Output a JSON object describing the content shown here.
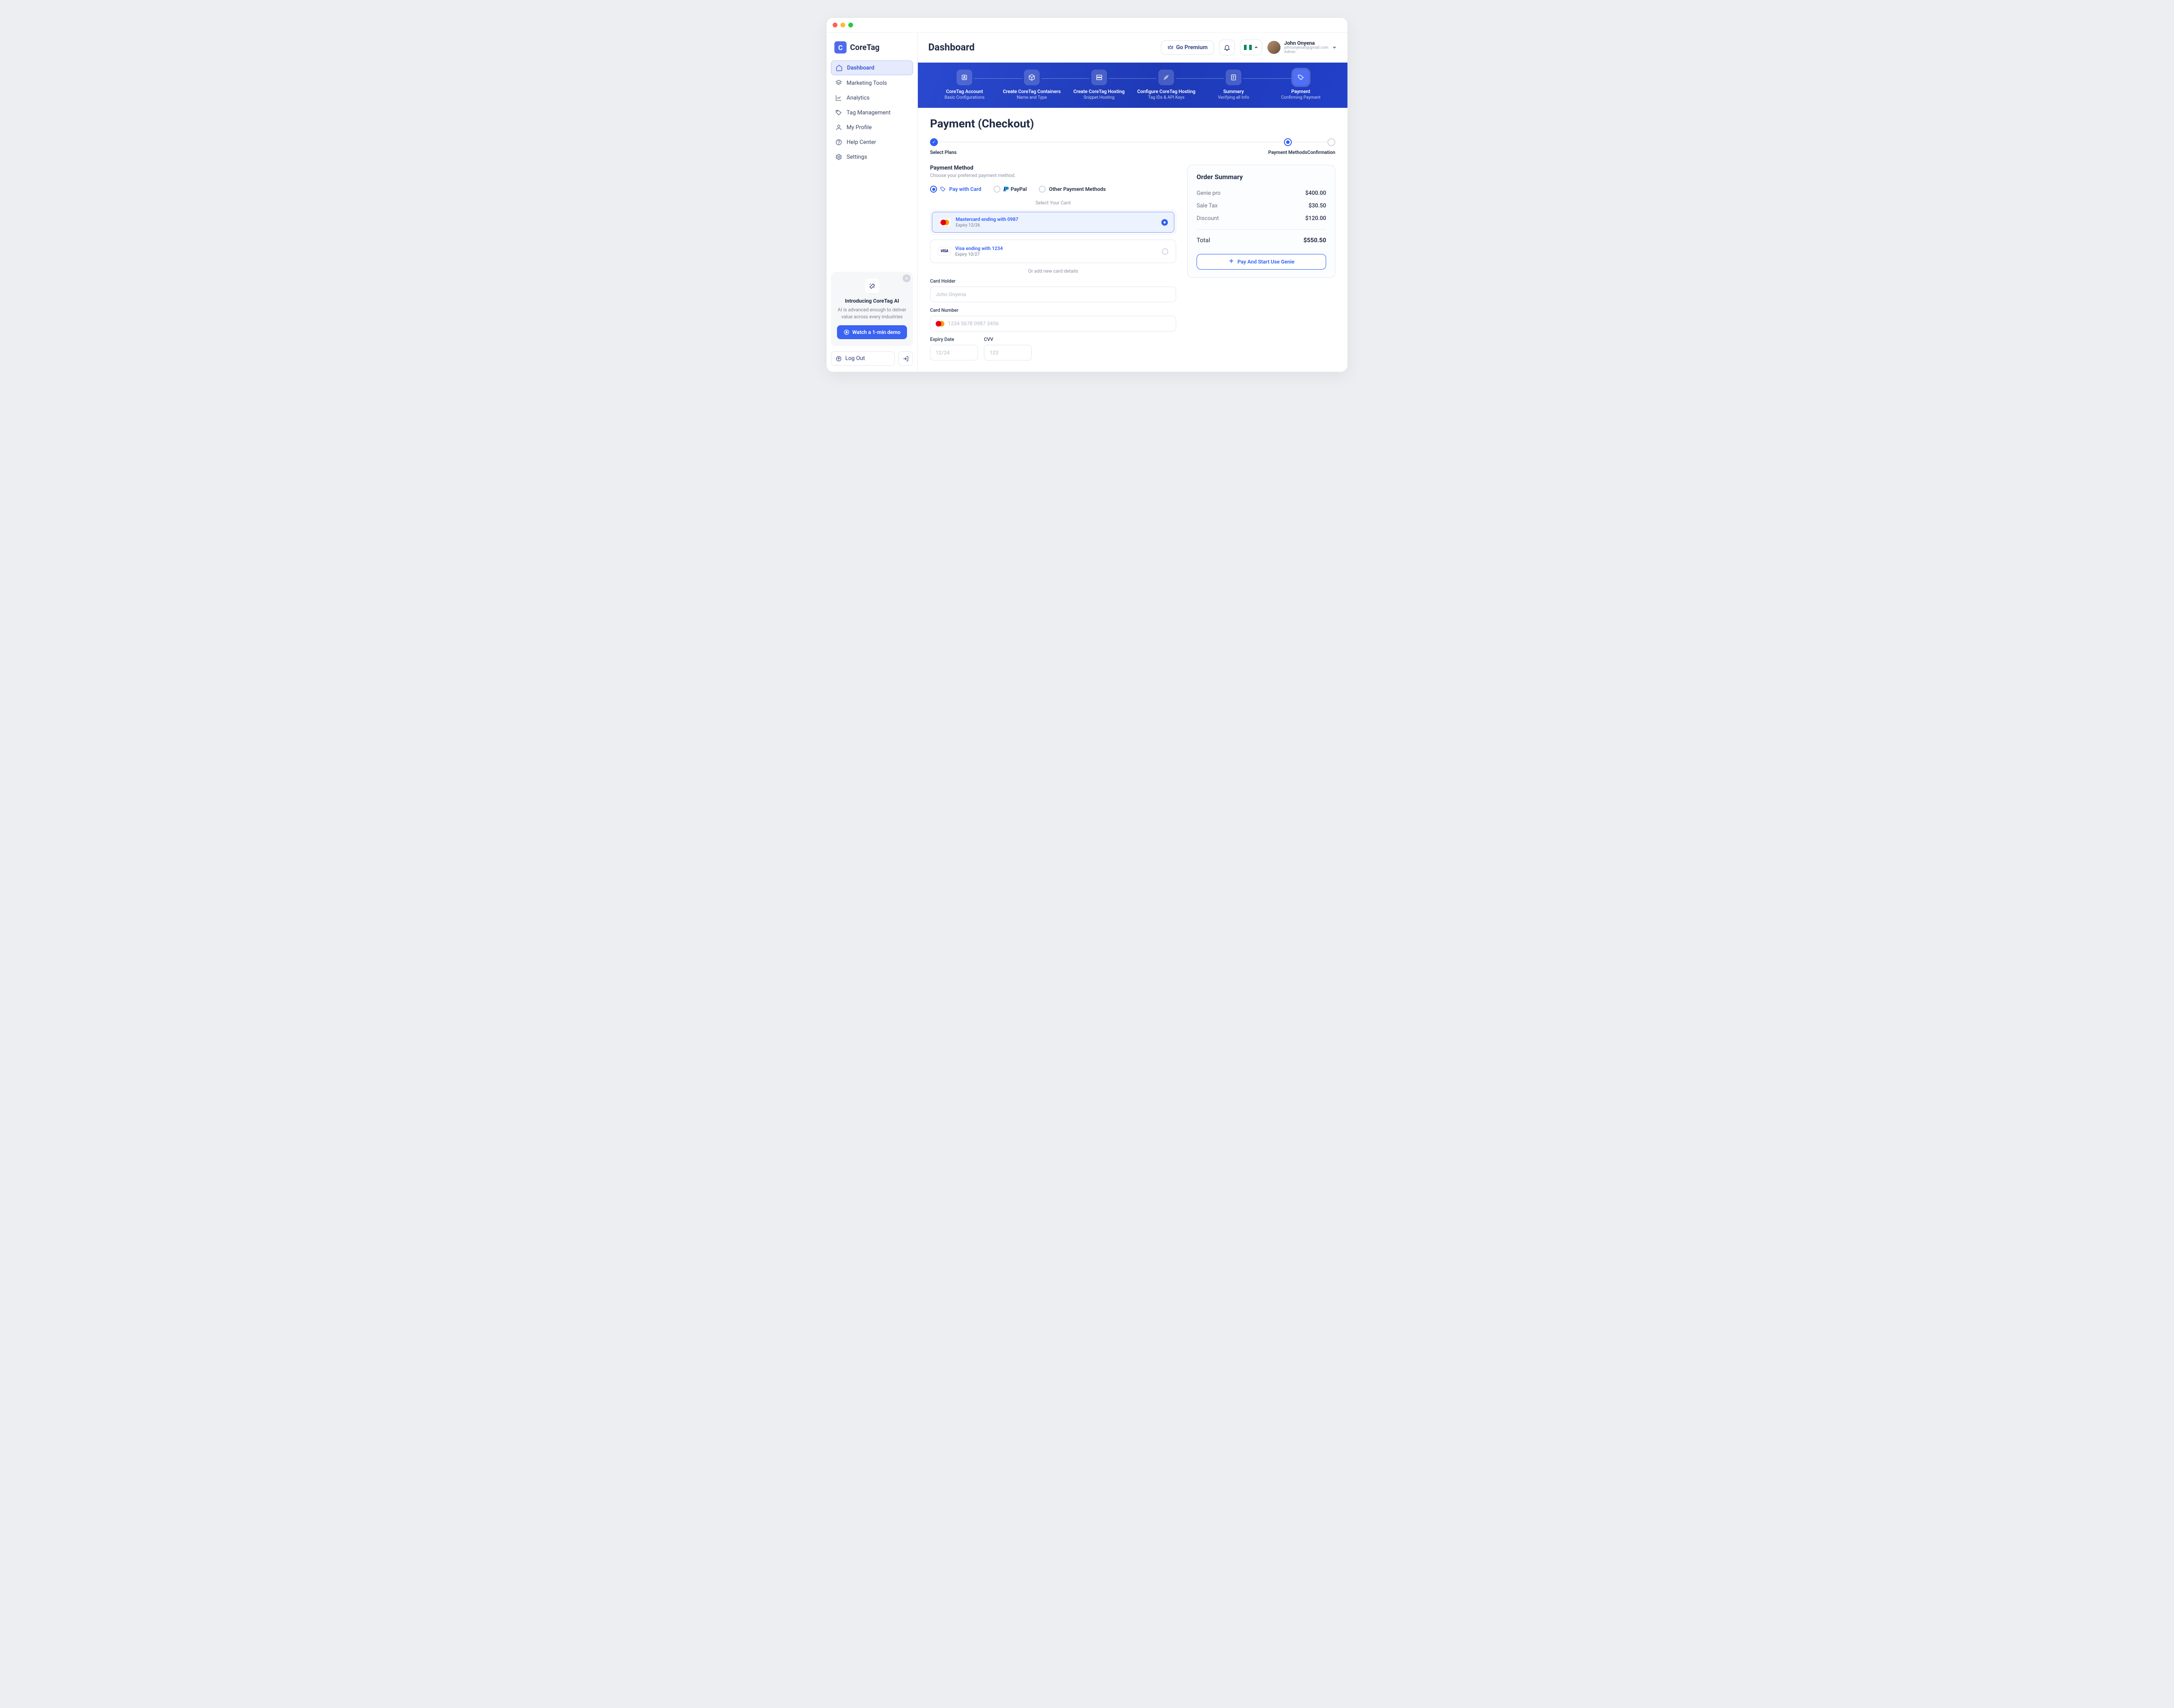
{
  "brand": "CoreTag",
  "page_title": "Dashboard",
  "header": {
    "premium": "Go Premium",
    "user": {
      "name": "John Onyena",
      "email": "johnonyena0@gmail.com",
      "role": "Admin"
    }
  },
  "nav": {
    "dashboard": "Dashboard",
    "marketing": "Marketing Tools",
    "analytics": "Analytics",
    "tag": "Tag Management",
    "profile": "My Profile",
    "help": "Help Center",
    "settings": "Settings"
  },
  "promo": {
    "title": "Introducing CoreTag AI",
    "text": "AI is advanced enough to deliver value across every industries",
    "cta": "Watch a 1-min demo"
  },
  "logout": "Log Out",
  "stepper": [
    {
      "title": "CoreTag Account",
      "sub": "Basic Configurations"
    },
    {
      "title": "Create CoreTag Containers",
      "sub": "Name and Type"
    },
    {
      "title": "Create CoreTag Hosting",
      "sub": "Snippet Hosting"
    },
    {
      "title": "Configure CoreTag Hosting",
      "sub": "Tag IDs & API Keys"
    },
    {
      "title": "Summary",
      "sub": "Verifying all Info"
    },
    {
      "title": "Payment",
      "sub": "Confirming Payment"
    }
  ],
  "checkout": {
    "title": "Payment (Checkout)",
    "progress": {
      "p1": "Select Plans",
      "p2": "Payment Methods",
      "p3": "Confirmation"
    },
    "method": {
      "heading": "Payment Method",
      "sub": "Choose your preferred payment method."
    },
    "options": {
      "card": "Pay with Card",
      "paypal": "PayPal",
      "other": "Other Payment Methods"
    },
    "select_card": "Select Your Card",
    "cards": [
      {
        "name": "Mastercard ending with 0987",
        "expiry": "Expiry 12/26"
      },
      {
        "name": "Visa ending with 1234",
        "expiry": "Expiry 10/27"
      }
    ],
    "add_new": "Or add new card details",
    "fields": {
      "holder": "Card Holder",
      "holder_ph": "John Onyena",
      "number": "Card Number",
      "number_ph": "1234 5678 0987 3456",
      "expiry": "Expiry Date",
      "expiry_ph": "12/24",
      "cvv": "CVV",
      "cvv_ph": "123"
    }
  },
  "summary": {
    "title": "Order Summary",
    "items": [
      {
        "k": "Genie pro",
        "v": "$400.00"
      },
      {
        "k": "Sale Tax",
        "v": "$30.50"
      },
      {
        "k": "Discount",
        "v": "$120.00"
      }
    ],
    "total": {
      "k": "Total",
      "v": "$550.50"
    },
    "cta": "Pay And Start Use Genie"
  }
}
